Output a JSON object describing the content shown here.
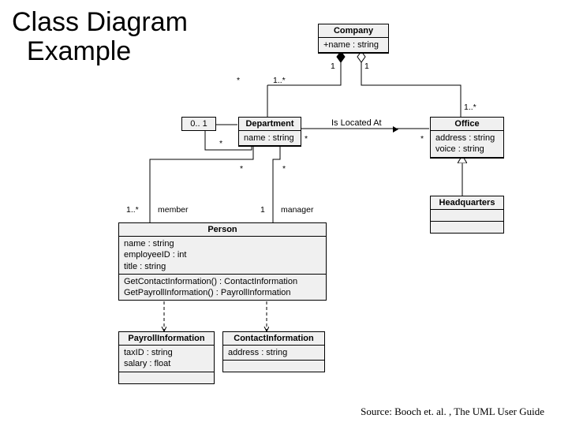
{
  "title_line1": "Class Diagram",
  "title_line2": "Example",
  "source": "Source: Booch et. al. , The UML User Guide",
  "classes": {
    "company": {
      "name": "Company",
      "attrs": [
        "+name : string"
      ]
    },
    "department": {
      "name": "Department",
      "attrs": [
        "name : string"
      ]
    },
    "office": {
      "name": "Office",
      "attrs": [
        "address : string",
        "voice : string"
      ]
    },
    "headquarters": {
      "name": "Headquarters"
    },
    "person": {
      "name": "Person",
      "attrs": [
        "name : string",
        "employeeID : int",
        "title : string"
      ],
      "ops": [
        "GetContactInformation() : ContactInformation",
        "GetPayrollInformation() : PayrollInformation"
      ]
    },
    "payroll": {
      "name": "PayrollInformation",
      "attrs": [
        "taxID : string",
        "salary : float"
      ]
    },
    "contact": {
      "name": "ContactInformation",
      "attrs": [
        "address : string"
      ]
    }
  },
  "associations": {
    "located": "Is Located At"
  },
  "multiplicities": {
    "company_dept_top": "1",
    "company_dept_far": "*",
    "company_dept_near": "1..*",
    "company_office_top": "1",
    "company_office_far": "1..*",
    "dept_self_parent": "0.. 1",
    "dept_self_child": "*",
    "dept_office_left": "*",
    "dept_office_right": "*",
    "dept_person_member_top": "*",
    "dept_person_member_bot": "1..*",
    "dept_person_member_role": "member",
    "dept_person_manager_top": "*",
    "dept_person_manager_bot": "1",
    "dept_person_manager_role": "manager"
  }
}
